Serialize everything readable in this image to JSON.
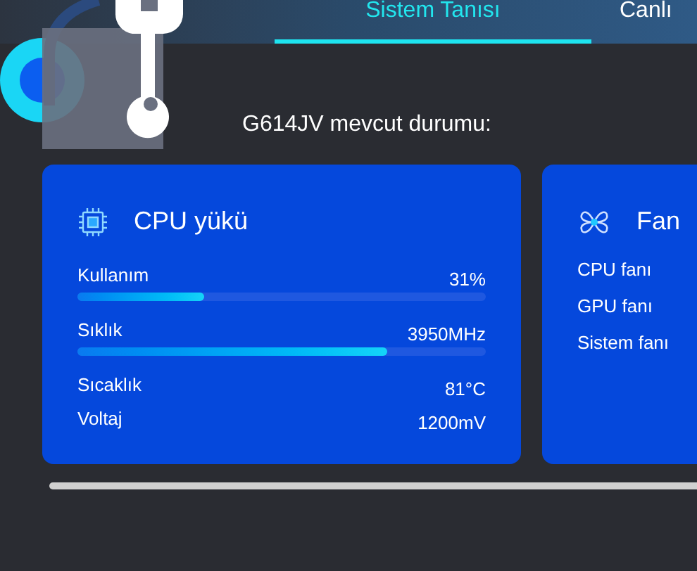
{
  "tabs": [
    {
      "label": "Sistem Tanısı",
      "selected": true
    },
    {
      "label": "Canlı",
      "selected": false
    }
  ],
  "heading": "G614JV mevcut durumu:",
  "cpu_card": {
    "title": "CPU yükü",
    "metrics": [
      {
        "kind": "bar",
        "label": "Kullanım",
        "reading": "31%",
        "level": 0.31
      },
      {
        "kind": "bar",
        "label": "Sıklık",
        "reading": "3950MHz",
        "level": 0.76
      },
      {
        "kind": "plain",
        "label": "Sıcaklık",
        "reading": "81°C"
      },
      {
        "kind": "plain",
        "label": "Voltaj",
        "reading": "1200mV"
      }
    ]
  },
  "fan_card": {
    "title": "Fan",
    "items": [
      "CPU fanı",
      "GPU fanı",
      "Sistem fanı"
    ]
  }
}
